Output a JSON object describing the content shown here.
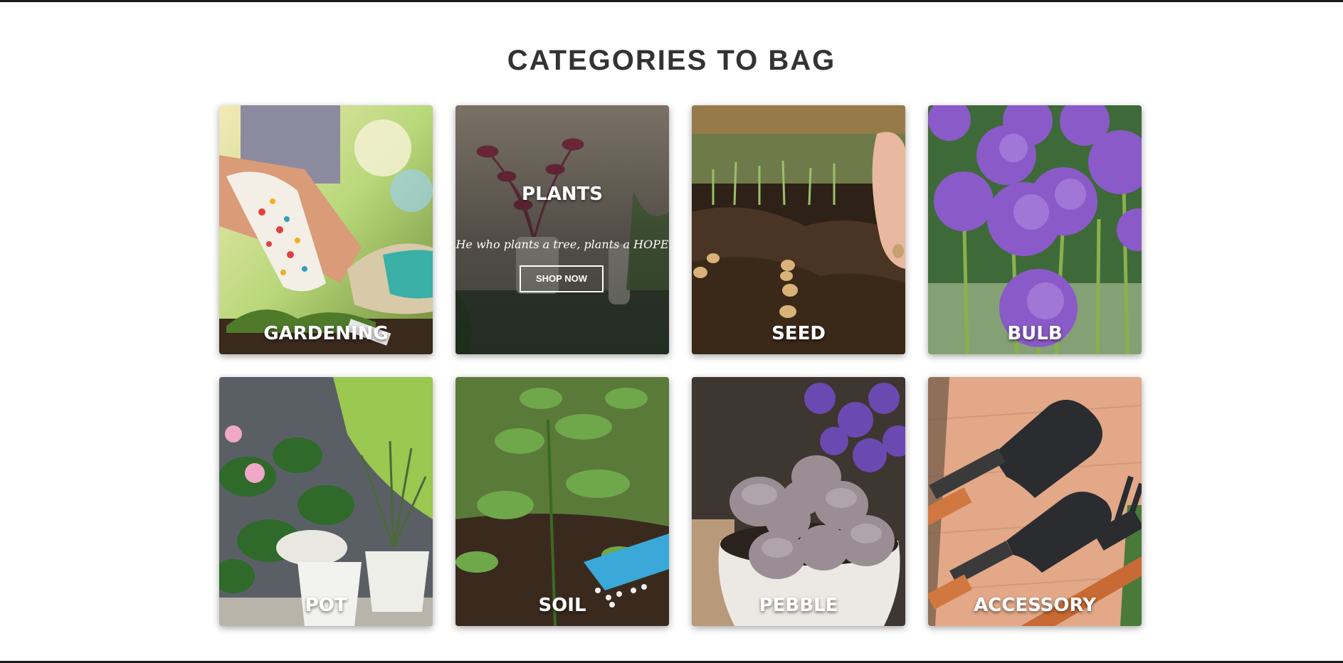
{
  "section": {
    "title": "CATEGORIES TO BAG"
  },
  "categories": [
    {
      "label": "GARDENING"
    },
    {
      "label": "PLANTS",
      "tagline": "He who plants a tree, plants a HOPE",
      "cta": "SHOP NOW"
    },
    {
      "label": "SEED"
    },
    {
      "label": "BULB"
    },
    {
      "label": "POT"
    },
    {
      "label": "SOIL"
    },
    {
      "label": "PEBBLE"
    },
    {
      "label": "ACCESSORY"
    }
  ],
  "colors": {
    "title": "#333333",
    "label": "#ffffff",
    "frame": "#1a1a1a"
  }
}
